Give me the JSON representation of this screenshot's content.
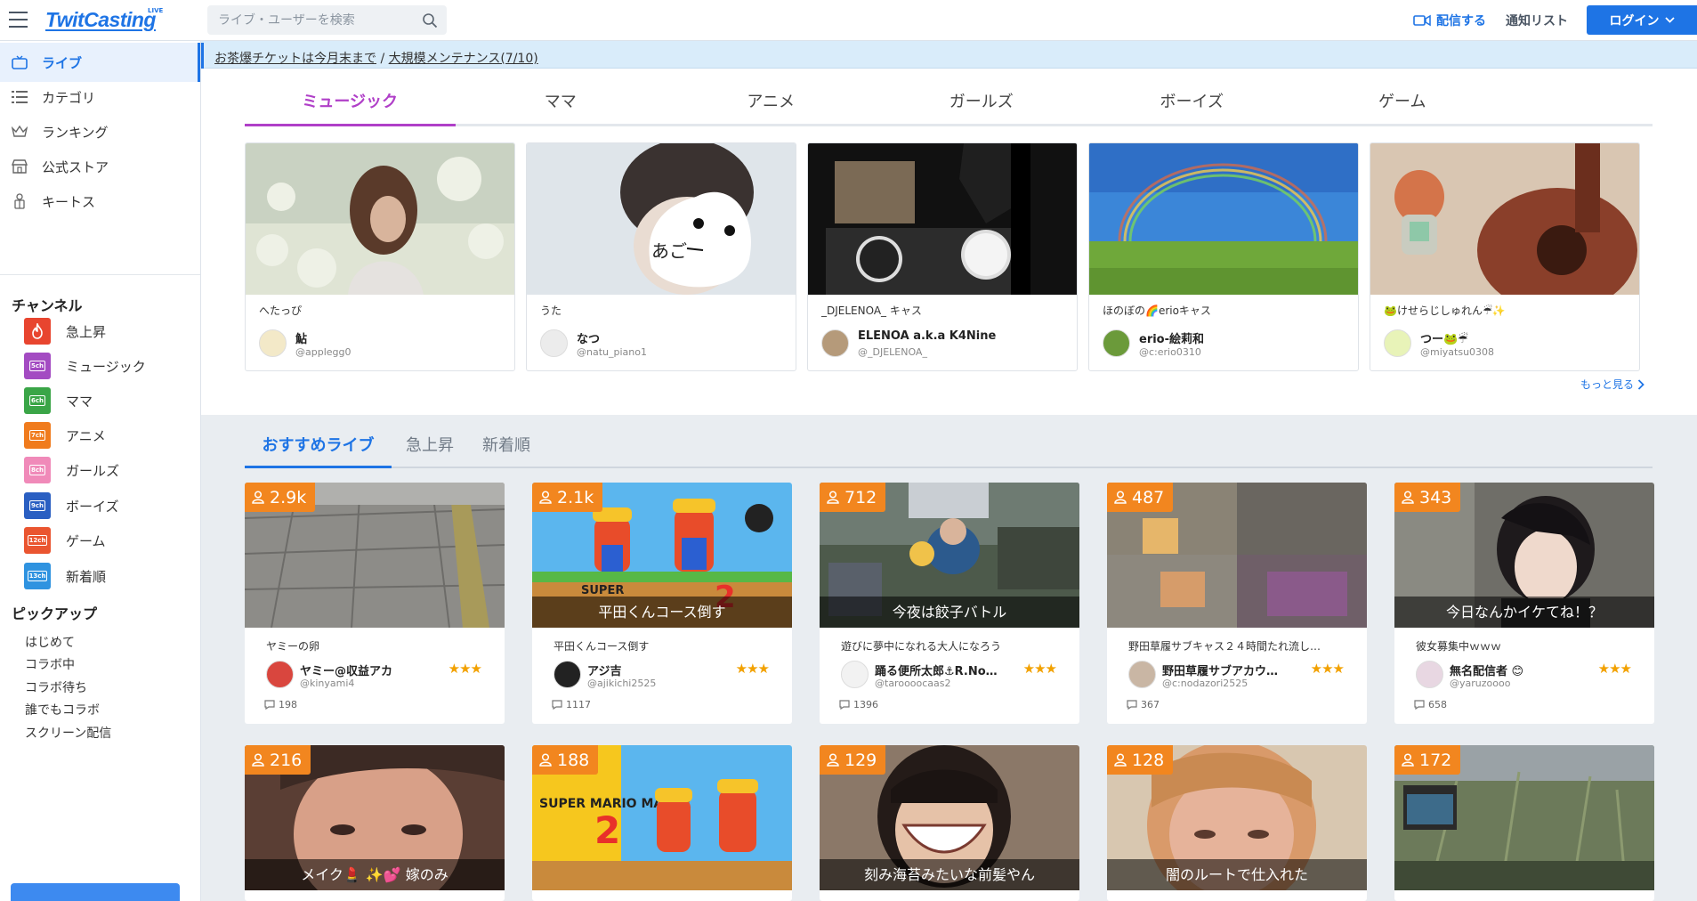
{
  "header": {
    "logo": "TwitCasting",
    "logo_sup": "LIVE",
    "search_placeholder": "ライブ・ユーザーを検索",
    "broadcast_label": "配信する",
    "notify_label": "通知リスト",
    "login_label": "ログイン"
  },
  "sidebar": {
    "nav": [
      {
        "label": "ライブ",
        "icon": "tv-icon"
      },
      {
        "label": "カテゴリ",
        "icon": "list-icon"
      },
      {
        "label": "ランキング",
        "icon": "crown-icon"
      },
      {
        "label": "公式ストア",
        "icon": "store-icon"
      },
      {
        "label": "キートス",
        "icon": "gift-person-icon"
      }
    ],
    "channel_heading": "チャンネル",
    "channels": [
      {
        "label": "急上昇",
        "badge": "",
        "color": "#e8452f"
      },
      {
        "label": "ミュージック",
        "badge": "5ch",
        "color": "#a34bc2"
      },
      {
        "label": "ママ",
        "badge": "6ch",
        "color": "#3aa547"
      },
      {
        "label": "アニメ",
        "badge": "7ch",
        "color": "#f07b1d"
      },
      {
        "label": "ガールズ",
        "badge": "8ch",
        "color": "#f08ab9"
      },
      {
        "label": "ボーイズ",
        "badge": "9ch",
        "color": "#2a5fc2"
      },
      {
        "label": "ゲーム",
        "badge": "12ch",
        "color": "#ea5530"
      },
      {
        "label": "新着順",
        "badge": "13ch",
        "color": "#2f93e0"
      }
    ],
    "pickup_heading": "ピックアップ",
    "pickup": [
      "はじめて",
      "コラボ中",
      "コラボ待ち",
      "誰でもコラボ",
      "スクリーン配信"
    ]
  },
  "notice": {
    "link1": "お茶爆チケットは今月末まで",
    "sep": " / ",
    "link2": "大規模メンテナンス(7/10)"
  },
  "category_tabs": [
    "ミュージック",
    "ママ",
    "アニメ",
    "ガールズ",
    "ボーイズ",
    "ゲーム"
  ],
  "category_cards": [
    {
      "title": "へたっぴ",
      "name": "鮎",
      "id": "@applegg0"
    },
    {
      "title": "うた",
      "name": "なつ",
      "id": "@natu_piano1"
    },
    {
      "title": "_DJELENOA_ キャス",
      "name": "ELENOA a.k.a K4Nine",
      "id": "@_DJELENOA_"
    },
    {
      "title": "ほのぼの🌈erioキャス",
      "name": "erio-絵莉和",
      "id": "@c:erio0310"
    },
    {
      "title": "🐸けせらじしゅれん☔✨",
      "name": "つー🐸☔",
      "id": "@miyatsu0308"
    }
  ],
  "more_label": "もっと見る",
  "live_tabs": [
    "おすすめライブ",
    "急上昇",
    "新着順"
  ],
  "live_cards": [
    {
      "viewers": "2.9k",
      "caption": "",
      "title": "ヤミーの卵",
      "name": "ヤミー@収益アカ",
      "id": "@kinyami4",
      "stars": "★★★",
      "comments": "198"
    },
    {
      "viewers": "2.1k",
      "caption": "平田くんコース倒す",
      "title": "平田くんコース倒す",
      "name": "アジ吉",
      "id": "@ajikichi2525",
      "stars": "★★★",
      "comments": "1117"
    },
    {
      "viewers": "712",
      "caption": "今夜は餃子バトル",
      "title": "遊びに夢中になれる大人になろう",
      "name": "踊る便所太郎⚓R.No…",
      "id": "@taroooocaas2",
      "stars": "★★★",
      "comments": "1396"
    },
    {
      "viewers": "487",
      "caption": "",
      "title": "野田草履サブキャス２４時間たれ流し…",
      "name": "野田草履サブアカウ…",
      "id": "@c:nodazori2525",
      "stars": "★★★",
      "comments": "367"
    },
    {
      "viewers": "343",
      "caption": "今日なんかイケてね！？",
      "title": "彼女募集中ｗｗｗ",
      "name": "無名配信者 😊",
      "id": "@yaruzoooo",
      "stars": "★★★",
      "comments": "658"
    },
    {
      "viewers": "216",
      "caption": "メイク💄 ✨💕 嫁のみ",
      "title": "",
      "name": "",
      "id": "",
      "stars": "",
      "comments": ""
    },
    {
      "viewers": "188",
      "caption": "",
      "title": "",
      "name": "",
      "id": "",
      "stars": "",
      "comments": ""
    },
    {
      "viewers": "129",
      "caption": "刻み海苔みたいな前髪やん",
      "title": "",
      "name": "",
      "id": "",
      "stars": "",
      "comments": ""
    },
    {
      "viewers": "128",
      "caption": "闇のルートで仕入れた",
      "title": "",
      "name": "",
      "id": "",
      "stars": "",
      "comments": ""
    },
    {
      "viewers": "172",
      "caption": "",
      "title": "",
      "name": "",
      "id": "",
      "stars": "",
      "comments": ""
    }
  ],
  "thumb_texts": {
    "mario_super": "SUPER",
    "mario_title": "SUPER MARIO MAKER",
    "mario_two": "2",
    "ago": "あご"
  }
}
